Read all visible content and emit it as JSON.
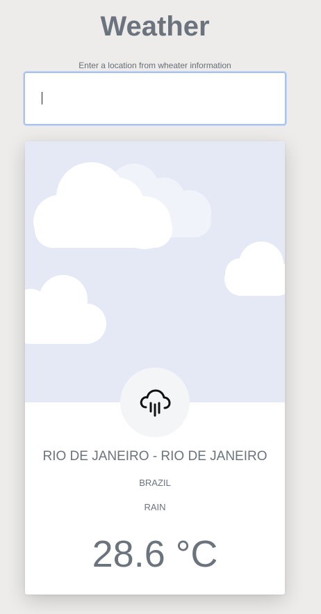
{
  "header": {
    "title": "Weather"
  },
  "search": {
    "label": "Enter a location from wheater information",
    "value": "",
    "placeholder": ""
  },
  "weather_card": {
    "city": "RIO DE JANEIRO - RIO DE JANEIRO",
    "country": "BRAZIL",
    "condition": "RAIN",
    "temperature": "28.6 °C",
    "icon": "cloud-rain-icon"
  },
  "colors": {
    "background": "#edecea",
    "sky": "#e4e9f5",
    "text": "#6b737c",
    "input_focus_border": "#a9c2ec"
  }
}
